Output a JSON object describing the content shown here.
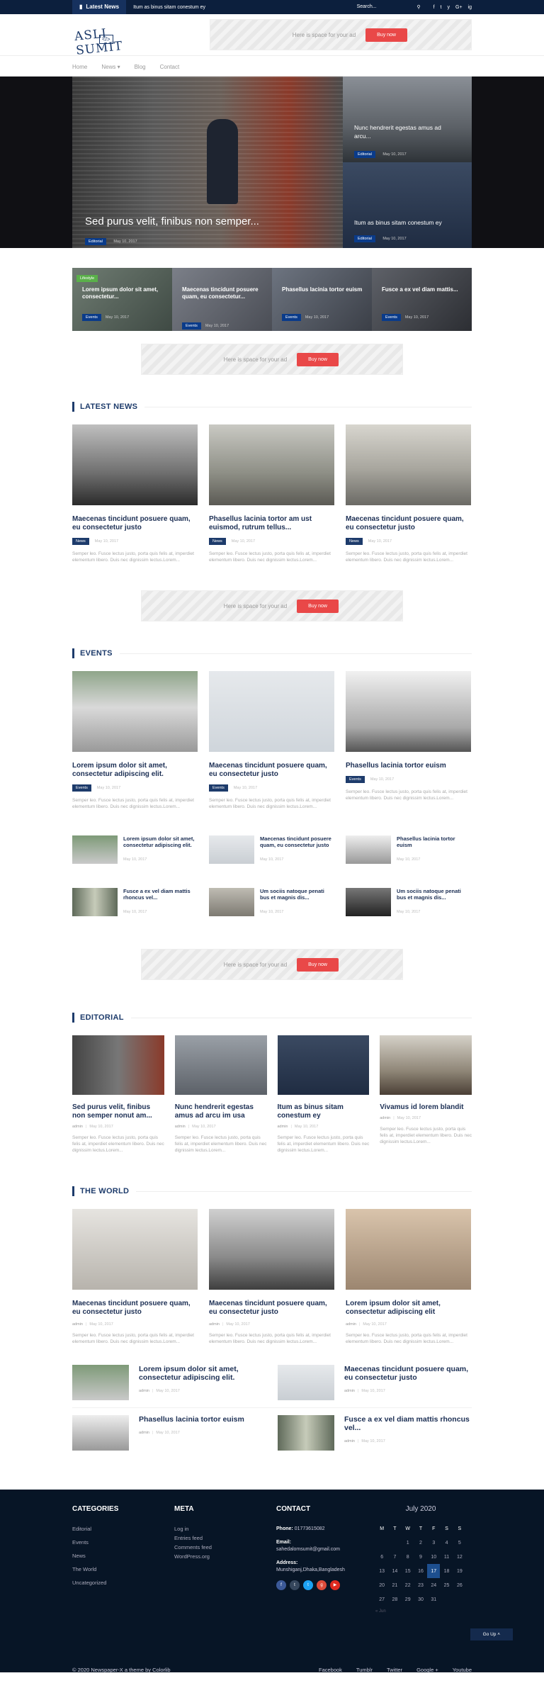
{
  "topbar": {
    "latest_label": "Latest News",
    "ticker": "Itum as binus sitam conestum ey",
    "search_placeholder": "Search...",
    "social": [
      "f",
      "t",
      "y",
      "G+",
      "ig"
    ]
  },
  "header": {
    "logo_text": "ASLI SUMIT",
    "logo_sub": "</>",
    "ad": {
      "text": "Here is space for your ad",
      "button": "Buy now"
    }
  },
  "nav": [
    "Home",
    "News ▾",
    "Blog",
    "Contact"
  ],
  "hero": {
    "main": {
      "title": "Sed purus velit, finibus non semper...",
      "badge": "Editorial",
      "date": "May 10, 2017"
    },
    "side": [
      {
        "title": "Nunc hendrerit egestas amus ad arcu...",
        "badge": "Editorial",
        "date": "May 10, 2017"
      },
      {
        "title": "Itum as binus sitam conestum ey",
        "badge": "Editorial",
        "date": "May 10, 2017"
      }
    ]
  },
  "strip": [
    {
      "cat": "Lifestyle",
      "title": "Lorem ipsum dolor sit amet, consectetur...",
      "badge": "Events",
      "date": "May 10, 2017"
    },
    {
      "cat": "",
      "title": "Maecenas tincidunt posuere quam, eu consectetur...",
      "badge": "Events",
      "date": "May 10, 2017"
    },
    {
      "cat": "",
      "title": "Phasellus lacinia tortor euism",
      "badge": "Events",
      "date": "May 10, 2017"
    },
    {
      "cat": "",
      "title": "Fusce a ex vel diam mattis...",
      "badge": "Events",
      "date": "May 10, 2017"
    }
  ],
  "ad": {
    "text": "Here is space for your ad",
    "button": "Buy now"
  },
  "latest": {
    "title": "LATEST NEWS",
    "cards": [
      {
        "title": "Maecenas tincidunt posuere quam, eu consectetur justo",
        "badge": "News",
        "date": "May 10, 2017",
        "excerpt": "Semper leo. Fusce lectus justo, porta quis felis at, imperdiet elementum libero. Duis nec dignissim lectus.Lorem..."
      },
      {
        "title": "Phasellus lacinia tortor am ust euismod, rutrum tellus...",
        "badge": "News",
        "date": "May 10, 2017",
        "excerpt": "Semper leo. Fusce lectus justo, porta quis felis at, imperdiet elementum libero. Duis nec dignissim lectus.Lorem..."
      },
      {
        "title": "Maecenas tincidunt posuere quam, eu consectetur justo",
        "badge": "News",
        "date": "May 10, 2017",
        "excerpt": "Semper leo. Fusce lectus justo, porta quis felis at, imperdiet elementum libero. Duis nec dignissim lectus.Lorem..."
      }
    ]
  },
  "events": {
    "title": "EVENTS",
    "cards": [
      {
        "title": "Lorem ipsum dolor sit amet, consectetur adipiscing elit.",
        "badge": "Events",
        "date": "May 10, 2017",
        "excerpt": "Semper leo. Fusce lectus justo, porta quis felis at, imperdiet elementum libero. Duis nec dignissim lectus.Lorem..."
      },
      {
        "title": "Maecenas tincidunt posuere quam, eu consectetur justo",
        "badge": "Events",
        "date": "May 10, 2017",
        "excerpt": "Semper leo. Fusce lectus justo, porta quis felis at, imperdiet elementum libero. Duis nec dignissim lectus.Lorem..."
      },
      {
        "title": "Phasellus lacinia tortor euism",
        "badge": "Events",
        "date": "May 10, 2017",
        "excerpt": "Semper leo. Fusce lectus justo, porta quis felis at, imperdiet elementum libero. Duis nec dignissim lectus.Lorem..."
      }
    ],
    "small": [
      {
        "title": "Lorem ipsum dolor sit amet, consectetur adipiscing elit.",
        "date": "May 10, 2017"
      },
      {
        "title": "Maecenas tincidunt posuere quam, eu consectetur justo",
        "date": "May 10, 2017"
      },
      {
        "title": "Phasellus lacinia tortor euism",
        "date": "May 10, 2017"
      },
      {
        "title": "Fusce a ex vel diam mattis rhoncus vel...",
        "date": "May 10, 2017"
      },
      {
        "title": "Um sociis natoque penati bus et magnis dis...",
        "date": "May 10, 2017"
      },
      {
        "title": "Um sociis natoque penati bus et magnis dis...",
        "date": "May 10, 2017"
      }
    ]
  },
  "editorial": {
    "title": "EDITORIAL",
    "cards": [
      {
        "title": "Sed purus velit, finibus non semper nonut am...",
        "author": "admin",
        "date": "May 10, 2017",
        "excerpt": "Semper leo. Fusce lectus justo, porta quis felis at, imperdiet elementum libero. Duis nec dignissim lectus.Lorem..."
      },
      {
        "title": "Nunc hendrerit egestas amus ad arcu im usa",
        "author": "admin",
        "date": "May 10, 2017",
        "excerpt": "Semper leo. Fusce lectus justo, porta quis felis at, imperdiet elementum libero. Duis nec dignissim lectus.Lorem..."
      },
      {
        "title": "Itum as binus sitam conestum ey",
        "author": "admin",
        "date": "May 10, 2017",
        "excerpt": "Semper leo. Fusce lectus justo, porta quis felis at, imperdiet elementum libero. Duis nec dignissim lectus.Lorem..."
      },
      {
        "title": "Vivamus id lorem blandit",
        "author": "admin",
        "date": "May 10, 2017",
        "excerpt": "Semper leo. Fusce lectus justo, porta quis felis at, imperdiet elementum libero. Duis nec dignissim lectus.Lorem..."
      }
    ]
  },
  "world": {
    "title": "THE WORLD",
    "cards": [
      {
        "title": "Maecenas tincidunt posuere quam, eu consectetur justo",
        "author": "admin",
        "date": "May 10, 2017",
        "excerpt": "Semper leo. Fusce lectus justo, porta quis felis at, imperdiet elementum libero. Duis nec dignissim lectus.Lorem..."
      },
      {
        "title": "Maecenas tincidunt posuere quam, eu consectetur justo",
        "author": "admin",
        "date": "May 10, 2017",
        "excerpt": "Semper leo. Fusce lectus justo, porta quis felis at, imperdiet elementum libero. Duis nec dignissim lectus.Lorem..."
      },
      {
        "title": "Lorem ipsum dolor sit amet, consectetur adipiscing elit",
        "author": "admin",
        "date": "May 10, 2017",
        "excerpt": "Semper leo. Fusce lectus justo, porta quis felis at, imperdiet elementum libero. Duis nec dignissim lectus.Lorem..."
      }
    ],
    "list": [
      {
        "title": "Lorem ipsum dolor sit amet, consectetur adipiscing elit.",
        "author": "admin",
        "date": "May 10, 2017"
      },
      {
        "title": "Maecenas tincidunt posuere quam, eu consectetur justo",
        "author": "admin",
        "date": "May 10, 2017"
      },
      {
        "title": "Phasellus lacinia tortor euism",
        "author": "admin",
        "date": "May 10, 2017"
      },
      {
        "title": "Fusce a ex vel diam mattis rhoncus vel...",
        "author": "admin",
        "date": "May 10, 2017"
      }
    ]
  },
  "footer": {
    "categories_title": "CATEGORIES",
    "categories": [
      "Editorial",
      "Events",
      "News",
      "The World",
      "Uncategorized"
    ],
    "meta_title": "META",
    "meta": [
      "Log in",
      "Entries feed",
      "Comments feed",
      "WordPress.org"
    ],
    "contact_title": "CONTACT",
    "phone_label": "Phone:",
    "phone": "01773615082",
    "email_label": "Email:",
    "email": "sahedalomsumit@gmail.com",
    "address_label": "Address:",
    "address": "Munshiganj,Dhaka,Bangladesh",
    "calendar": {
      "title": "July 2020",
      "days": [
        "M",
        "T",
        "W",
        "T",
        "F",
        "S",
        "S"
      ],
      "weeks": [
        [
          "",
          "",
          "1",
          "2",
          "3",
          "4",
          "5"
        ],
        [
          "6",
          "7",
          "8",
          "9",
          "10",
          "11",
          "12"
        ],
        [
          "13",
          "14",
          "15",
          "16",
          "17",
          "18",
          "19"
        ],
        [
          "20",
          "21",
          "22",
          "23",
          "24",
          "25",
          "26"
        ],
        [
          "27",
          "28",
          "29",
          "30",
          "31",
          "",
          ""
        ]
      ],
      "today": "17",
      "prev": "« Jun"
    },
    "goup": "Go Up",
    "copyright": "© 2020 Newspaper-X a theme by Colorlib",
    "links": [
      "Facebook",
      "Tumblr",
      "Twitter",
      "Google +",
      "Youtube"
    ]
  },
  "colors": {
    "navy": "#0c1f3d",
    "accent": "#1d3b6b",
    "button": "#e94848",
    "footer": "#071526"
  }
}
